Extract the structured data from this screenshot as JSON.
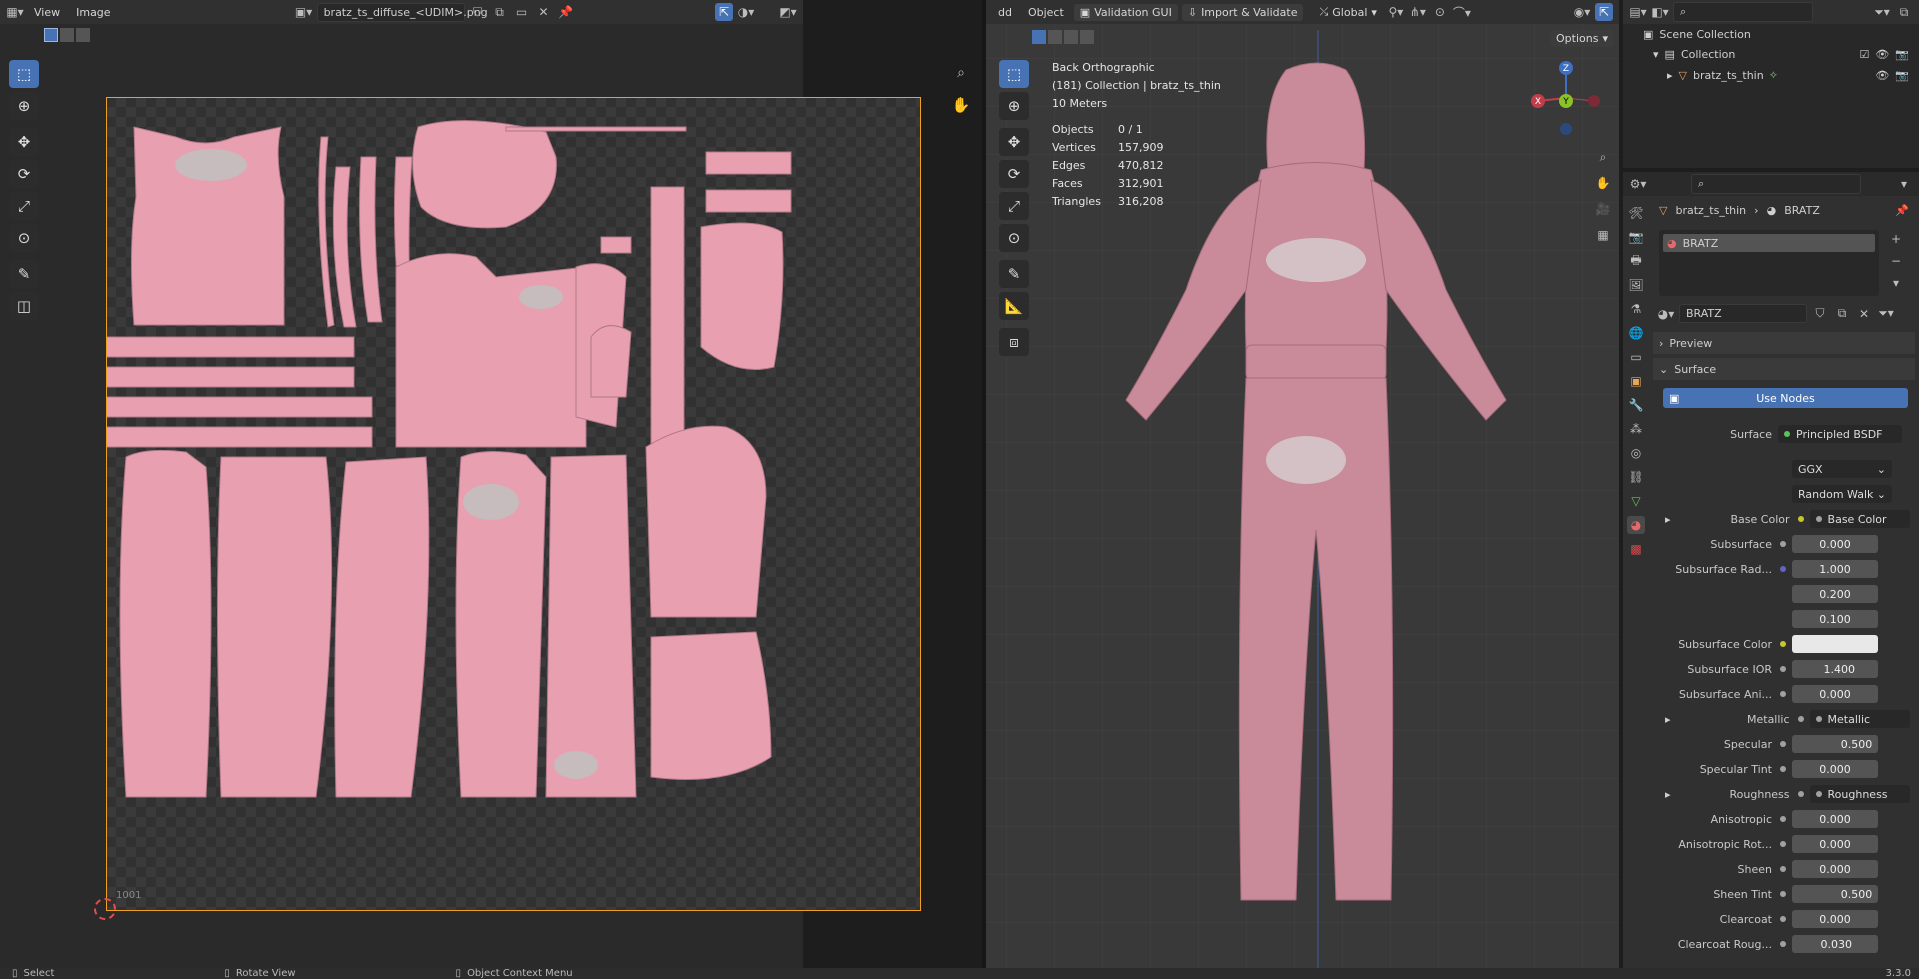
{
  "image_editor": {
    "menus": [
      "View",
      "Image"
    ],
    "image_name": "bratz_ts_diffuse_<UDIM>.png",
    "udim_label": "1001"
  },
  "viewport": {
    "menus": [
      "dd",
      "Object"
    ],
    "validation_button": "Validation GUI",
    "import_button": "Import & Validate",
    "orientation": "Global",
    "options": "Options",
    "view_name": "Back Orthographic",
    "collection_info": "(181) Collection | bratz_ts_thin",
    "scale": "10 Meters",
    "stats": [
      {
        "label": "Objects",
        "value": "0 / 1"
      },
      {
        "label": "Vertices",
        "value": "157,909"
      },
      {
        "label": "Edges",
        "value": "470,812"
      },
      {
        "label": "Faces",
        "value": "312,901"
      },
      {
        "label": "Triangles",
        "value": "316,208"
      }
    ],
    "gizmo": {
      "x": "X",
      "y": "Y",
      "z": "Z"
    }
  },
  "outliner": {
    "items": [
      "Scene Collection",
      "Collection",
      "bratz_ts_thin"
    ]
  },
  "properties": {
    "breadcrumb_object": "bratz_ts_thin",
    "breadcrumb_material": "BRATZ",
    "slot_name": "BRATZ",
    "material_name": "BRATZ",
    "preview_label": "Preview",
    "surface_label": "Surface",
    "use_nodes": "Use Nodes",
    "surface_shader_label": "Surface",
    "surface_shader": "Principled BSDF",
    "distribution": "GGX",
    "subsurface_method": "Random Walk",
    "rows": [
      {
        "label": "Base Color",
        "type": "link",
        "value": "Base Color",
        "expand": true,
        "socket": "#c7c729"
      },
      {
        "label": "Subsurface",
        "type": "num",
        "value": "0.000",
        "fill": 0
      },
      {
        "label": "Subsurface Rad...",
        "type": "num",
        "value": "1.000",
        "fill": 0,
        "socket": "#6363c7"
      },
      {
        "label": "",
        "type": "num",
        "value": "0.200",
        "fill": 0,
        "nosocket": true
      },
      {
        "label": "",
        "type": "num",
        "value": "0.100",
        "fill": 0,
        "nosocket": true
      },
      {
        "label": "Subsurface Color",
        "type": "color",
        "value": "#e8e8e8",
        "socket": "#c7c729"
      },
      {
        "label": "Subsurface IOR",
        "type": "num",
        "value": "1.400",
        "fill": 0.1
      },
      {
        "label": "Subsurface Ani...",
        "type": "num",
        "value": "0.000",
        "fill": 0
      },
      {
        "label": "Metallic",
        "type": "link",
        "value": "Metallic",
        "expand": true
      },
      {
        "label": "Specular",
        "type": "num",
        "value": "0.500",
        "fill": 0.5
      },
      {
        "label": "Specular Tint",
        "type": "num",
        "value": "0.000",
        "fill": 0
      },
      {
        "label": "Roughness",
        "type": "link",
        "value": "Roughness",
        "expand": true
      },
      {
        "label": "Anisotropic",
        "type": "num",
        "value": "0.000",
        "fill": 0
      },
      {
        "label": "Anisotropic Rot...",
        "type": "num",
        "value": "0.000",
        "fill": 0
      },
      {
        "label": "Sheen",
        "type": "num",
        "value": "0.000",
        "fill": 0
      },
      {
        "label": "Sheen Tint",
        "type": "num",
        "value": "0.500",
        "fill": 0.5
      },
      {
        "label": "Clearcoat",
        "type": "num",
        "value": "0.000",
        "fill": 0
      },
      {
        "label": "Clearcoat Roug...",
        "type": "num",
        "value": "0.030",
        "fill": 0.03
      }
    ]
  },
  "statusbar": {
    "select": "Select",
    "rotate": "Rotate View",
    "context": "Object Context Menu",
    "version": "3.3.0"
  },
  "colors": {
    "accent": "#4772b3",
    "uv_pink": "#e8a0b0",
    "hoodie_pink": "#c98a9a",
    "udim_border": "#f0a020"
  }
}
